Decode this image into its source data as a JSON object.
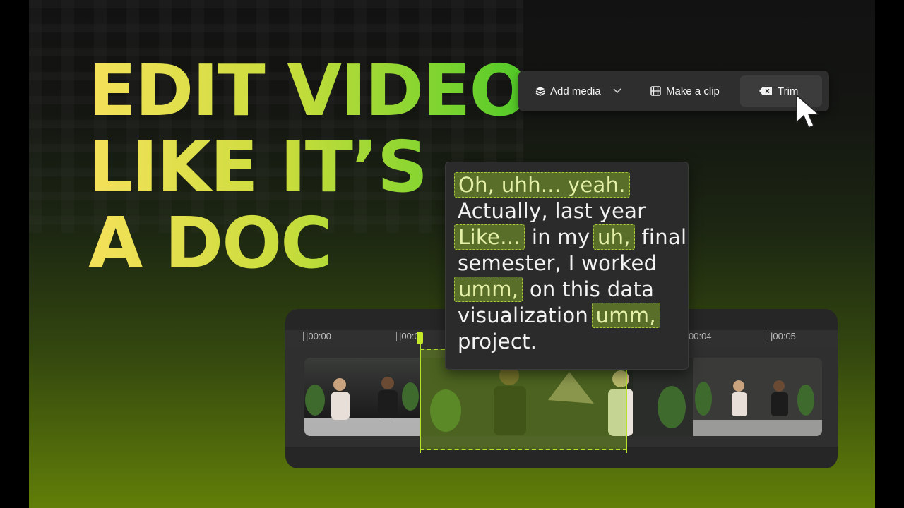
{
  "headline": [
    "EDIT VIDEO",
    "LIKE IT’S",
    "A DOC"
  ],
  "toolbar": {
    "add_media": "Add media",
    "make_clip": "Make a clip",
    "trim": "Trim"
  },
  "timeline": {
    "ticks": [
      "|00:00",
      "|00:0",
      "00:04",
      "|00:05"
    ]
  },
  "transcript": {
    "l1_hl": "Oh, uhh... yeah.",
    "l2": "Actually, last year",
    "l3_hl1": "Like…",
    "l3_mid": " in my ",
    "l3_hl2": "uh,",
    "l3_end": " final",
    "l4": "semester, I worked",
    "l5_hl": "umm,",
    "l5_end": " on this data",
    "l6_start": "visualization ",
    "l6_hl": "umm,",
    "l7": "project."
  },
  "colors": {
    "accent": "#b7e02a",
    "headline_start": "#f5e15a",
    "headline_end": "#4fc828"
  }
}
